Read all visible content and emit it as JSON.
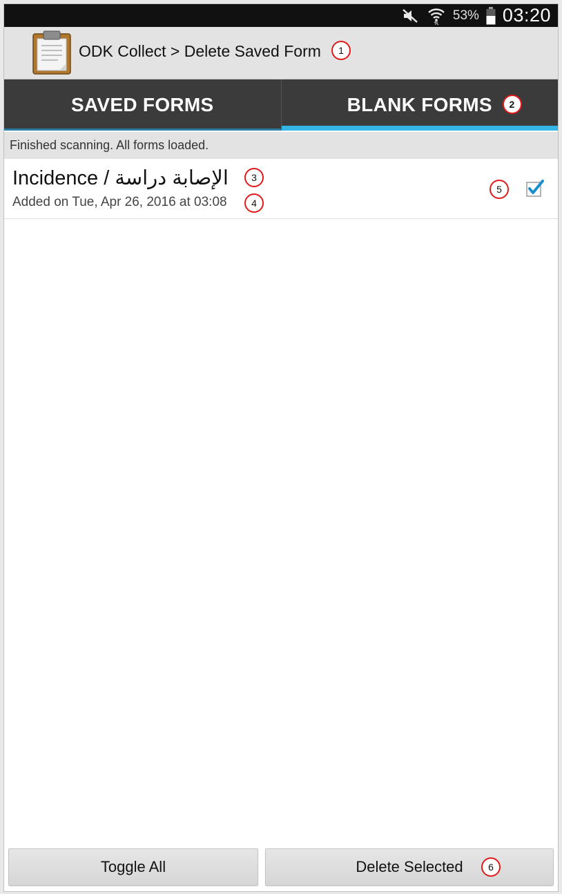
{
  "status_bar": {
    "battery_percent": "53%",
    "time": "03:20",
    "icons": [
      "mute-icon",
      "wifi-icon",
      "battery-icon"
    ]
  },
  "action_bar": {
    "title": "ODK Collect > Delete Saved Form",
    "app_icon": "clipboard-icon"
  },
  "tabs": [
    {
      "label": "SAVED FORMS",
      "selected": false
    },
    {
      "label": "BLANK FORMS",
      "selected": true
    }
  ],
  "message": "Finished scanning. All forms loaded.",
  "list": {
    "items": [
      {
        "title": "Incidence / الإصابة دراسة",
        "subtitle": "Added on Tue, Apr 26, 2016 at 03:08",
        "checked": true
      }
    ]
  },
  "buttons": {
    "toggle_all": "Toggle All",
    "delete_selected": "Delete Selected"
  },
  "annotations": [
    "1",
    "2",
    "3",
    "4",
    "5",
    "6"
  ],
  "colors": {
    "tab_indicator": "#33b5e5",
    "tab_background": "#3b3b3b",
    "annotation_circle": "#e01a1a",
    "checkbox_check": "#1a8fd0"
  }
}
